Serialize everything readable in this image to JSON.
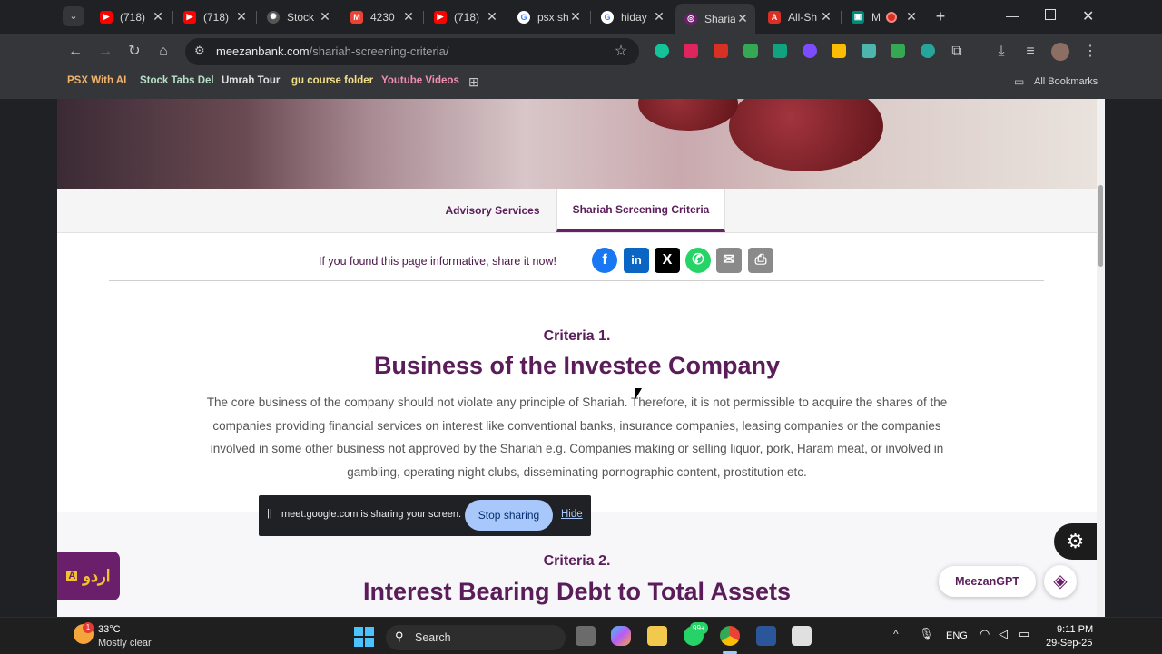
{
  "browser": {
    "tabs": [
      {
        "title": "(718)",
        "favicon": "youtube-icon",
        "color": "#ff0000"
      },
      {
        "title": "(718)",
        "favicon": "youtube-icon",
        "color": "#ff0000"
      },
      {
        "title": "Stock",
        "favicon": "openai-icon",
        "color": "#808080"
      },
      {
        "title": "4230",
        "favicon": "gmail-icon",
        "color": "#ea4335"
      },
      {
        "title": "(718)",
        "favicon": "youtube-icon",
        "color": "#ff0000"
      },
      {
        "title": "psx sh",
        "favicon": "google-icon",
        "color": "#4285f4"
      },
      {
        "title": "hiday",
        "favicon": "google-icon",
        "color": "#4285f4"
      },
      {
        "title": "Sharia",
        "favicon": "meezan-icon",
        "color": "#6b1f6b"
      },
      {
        "title": "All-Sh",
        "favicon": "pdf-icon",
        "color": "#d93025"
      },
      {
        "title": "M",
        "favicon": "meet-icon",
        "color": "#00897b"
      }
    ],
    "url_host": "meezanbank.com",
    "url_path": "/shariah-screening-criteria/",
    "bookmarks": [
      "PSX With AI",
      "Stock Tabs Del",
      "Umrah Tour",
      "gu course folder",
      "Youtube Videos"
    ],
    "all_bookmarks": "All Bookmarks"
  },
  "page": {
    "tabs": [
      "Advisory Services",
      "Shariah Screening Criteria"
    ],
    "active_tab": "Shariah Screening Criteria",
    "share_prompt": "If you found this page informative, share it now!",
    "share_icons": [
      "facebook-icon",
      "linkedin-icon",
      "x-icon",
      "whatsapp-icon",
      "email-icon",
      "print-icon"
    ],
    "criteria1_label": "Criteria 1.",
    "criteria1_title": "Business of the Investee Company",
    "criteria1_body": "The core business of the company should not violate any principle of Shariah. Therefore, it is not permissible to acquire the shares of the companies providing financial services on interest like conventional banks, insurance companies, leasing companies or the companies involved in some other business not approved by the Shariah e.g. Companies making or selling liquor, pork, Haram meat, or involved in gambling, operating night clubs, disseminating pornographic content, prostitution etc.",
    "criteria2_label": "Criteria 2.",
    "criteria2_title": "Interest Bearing Debt to Total Assets",
    "urdu_button": "اردو",
    "gpt_button": "MeezanGPT"
  },
  "screen_share": {
    "message": "meet.google.com is sharing your screen.",
    "stop": "Stop sharing",
    "hide": "Hide"
  },
  "taskbar": {
    "temp": "33°C",
    "weather": "Mostly clear",
    "search": "Search",
    "lang": "ENG",
    "time": "9:11 PM",
    "date": "29-Sep-25",
    "whatsapp_badge": "99+",
    "weather_badge": "1"
  }
}
